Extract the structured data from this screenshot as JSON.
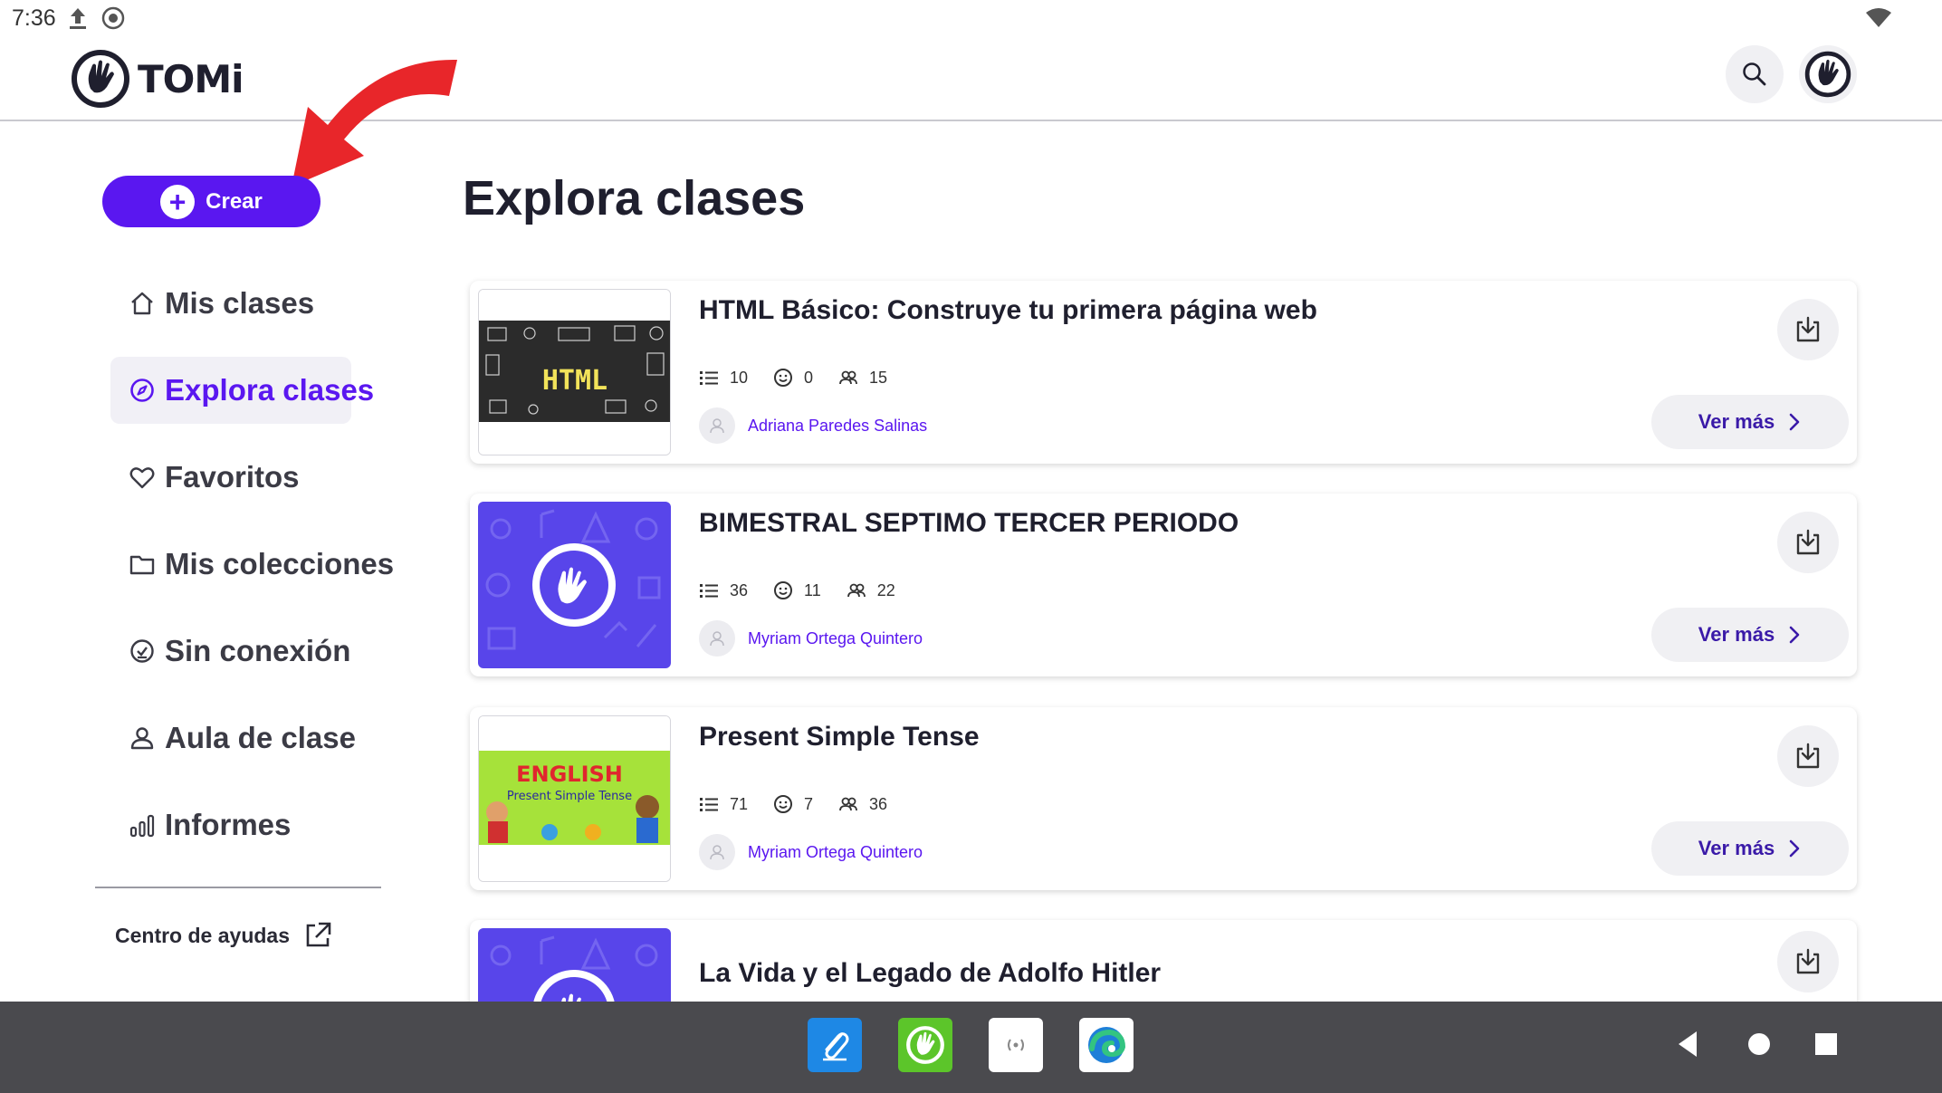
{
  "status_bar": {
    "time": "7:36",
    "icons": [
      "upload-icon",
      "sync-icon",
      "wifi-icon"
    ]
  },
  "header": {
    "brand": "TOMi",
    "search_icon": "search-icon",
    "avatar_icon": "hand-logo-icon"
  },
  "sidebar": {
    "create_label": "Crear",
    "items": [
      {
        "label": "Mis clases",
        "icon": "home-icon",
        "active": false
      },
      {
        "label": "Explora clases",
        "icon": "compass-icon",
        "active": true
      },
      {
        "label": "Favoritos",
        "icon": "heart-icon",
        "active": false
      },
      {
        "label": "Mis colecciones",
        "icon": "folder-icon",
        "active": false
      },
      {
        "label": "Sin conexión",
        "icon": "offline-check-icon",
        "active": false
      },
      {
        "label": "Aula de clase",
        "icon": "users-icon",
        "active": false
      },
      {
        "label": "Informes",
        "icon": "bar-chart-icon",
        "active": false
      }
    ],
    "help_label": "Centro de ayudas"
  },
  "main": {
    "title": "Explora clases",
    "cards": [
      {
        "title": "HTML Básico: Construye tu primera página web",
        "thumbnail": "html-chalkboard",
        "thumb_text": "HTML",
        "slides": "10",
        "reactions": "0",
        "students": "15",
        "author": "Adriana Paredes Salinas",
        "more_label": "Ver más"
      },
      {
        "title": "BIMESTRAL SEPTIMO TERCER PERIODO",
        "thumbnail": "tomi-default",
        "slides": "36",
        "reactions": "11",
        "students": "22",
        "author": "Myriam Ortega Quintero",
        "more_label": "Ver más"
      },
      {
        "title": "Present Simple Tense",
        "thumbnail": "english-present-simple",
        "thumb_text": "ENGLISH",
        "thumb_subtext": "Present Simple Tense",
        "slides": "71",
        "reactions": "7",
        "students": "36",
        "author": "Myriam Ortega Quintero",
        "more_label": "Ver más"
      },
      {
        "title": "La Vida y el Legado de Adolfo Hitler",
        "thumbnail": "tomi-default"
      }
    ]
  },
  "system_bar": {
    "dock_apps": [
      "paperclip-app-icon",
      "tomi-app-icon",
      "cast-app-icon",
      "edge-browser-icon"
    ],
    "nav": [
      "back-icon",
      "home-icon",
      "recents-icon"
    ]
  },
  "colors": {
    "accent": "#5a17f0",
    "annotation_arrow": "#e8262a",
    "system_bar": "#4a4a4e"
  }
}
